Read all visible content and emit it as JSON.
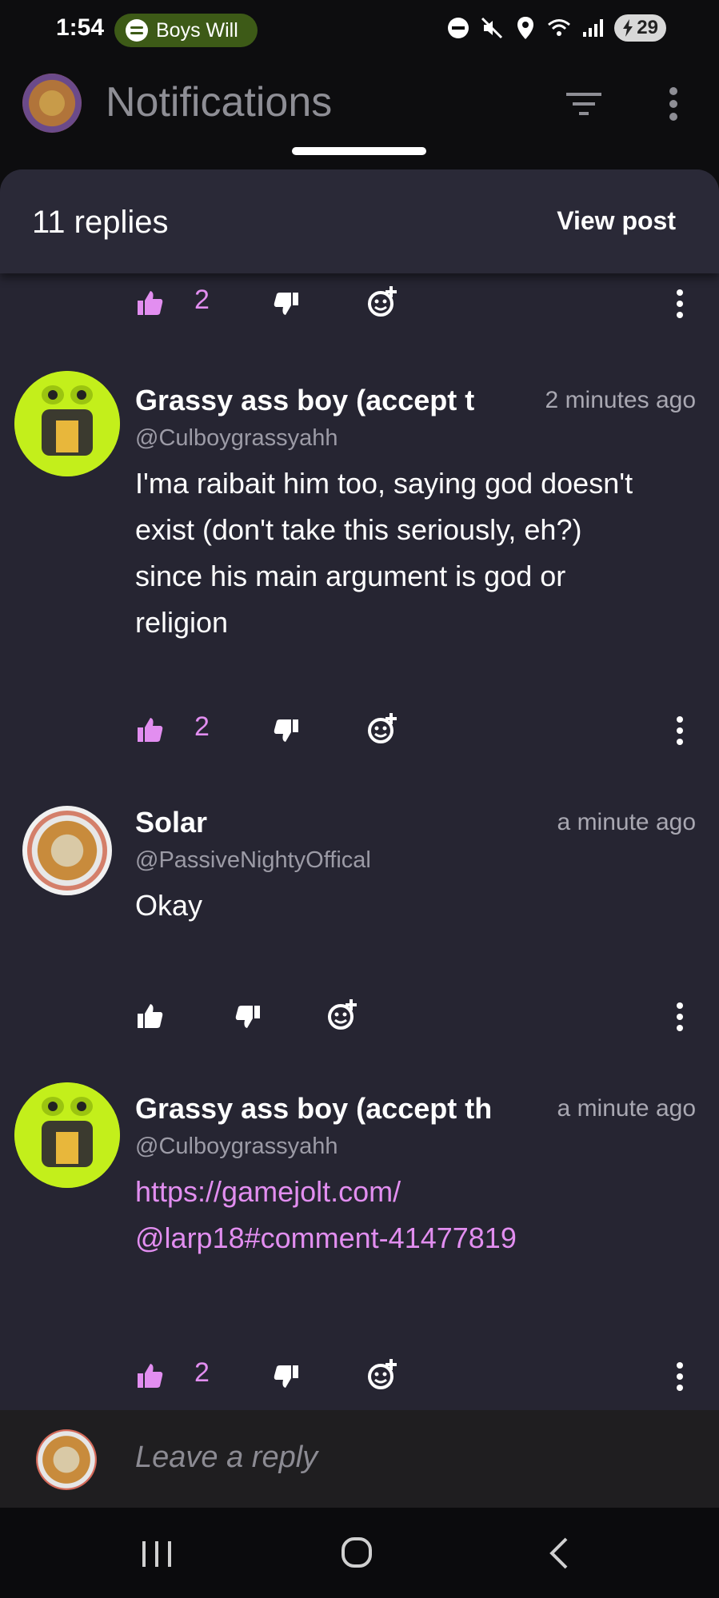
{
  "status_bar": {
    "time": "1:54",
    "spotify_label": "Boys Will",
    "battery": "29"
  },
  "header": {
    "title": "Notifications"
  },
  "sheet": {
    "replies_count": "11 replies",
    "view_post_label": "View post"
  },
  "top_actions": {
    "likes": "2"
  },
  "comments": [
    {
      "name": "Grassy ass boy (accept t",
      "time": "2 minutes ago",
      "handle": "@Culboygrassyahh",
      "body": "I'ma raibait him too, saying god doesn't exist (don't take this seriously, eh?) since his main argument is god or religion",
      "likes": "2"
    },
    {
      "name": "Solar",
      "time": "a minute ago",
      "handle": "@PassiveNightyOffical",
      "body": "Okay",
      "likes": ""
    },
    {
      "name": "Grassy ass boy (accept th",
      "time": "a minute ago",
      "handle": "@Culboygrassyahh",
      "body_line1": "https://gamejolt.com/",
      "body_line2": "@larp18#comment-41477819",
      "likes": "2"
    }
  ],
  "reply_bar": {
    "placeholder": "Leave a reply"
  },
  "colors": {
    "accent": "#e28ef0",
    "sheet_bg": "#262532",
    "frog_green": "#c3ef1b"
  }
}
